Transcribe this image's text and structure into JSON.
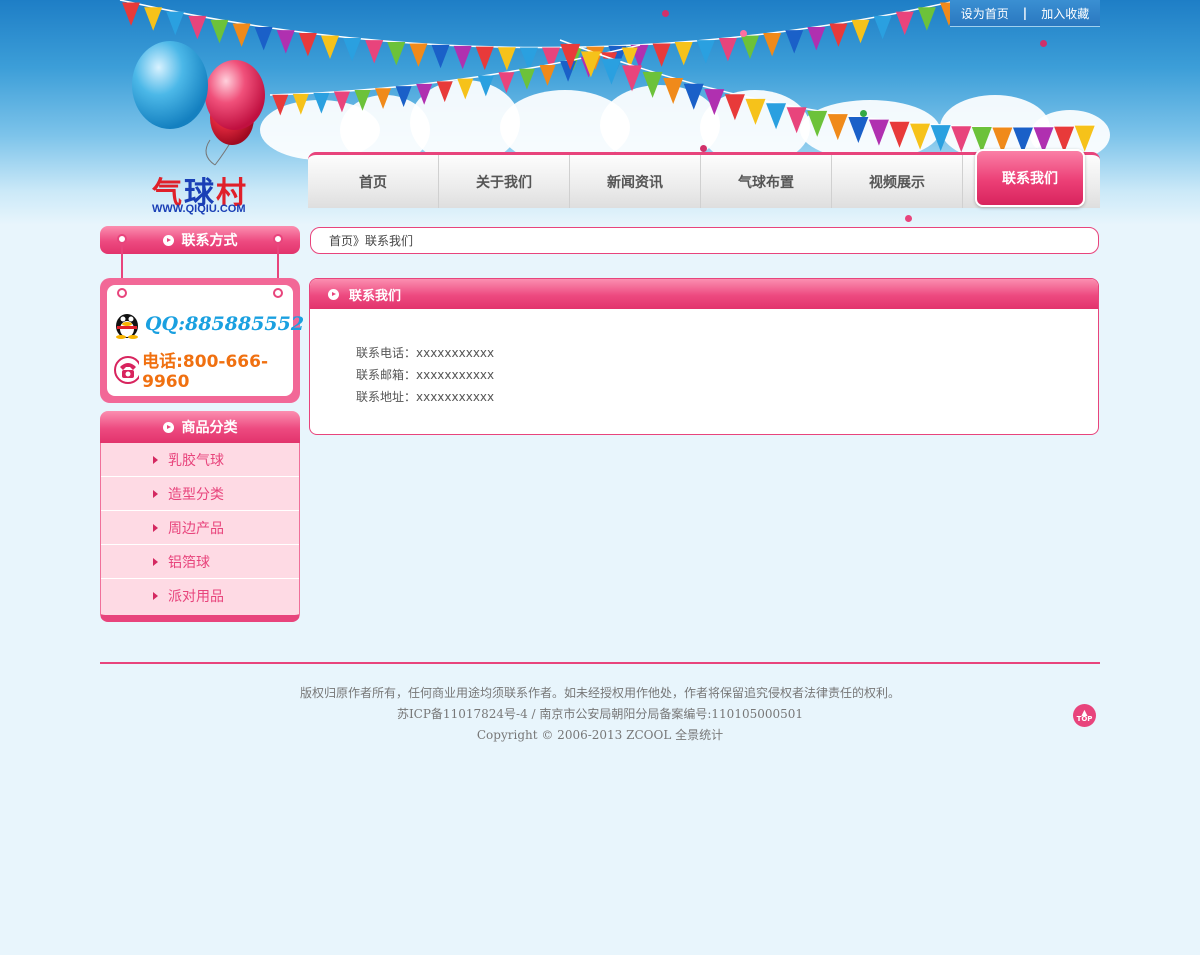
{
  "top_links": {
    "home": "设为首页",
    "favorite": "加入收藏"
  },
  "logo": {
    "text1": "气",
    "text2": "球",
    "text3": "村",
    "url": "WWW.QIQIU.COM"
  },
  "nav": [
    {
      "label": "首页"
    },
    {
      "label": "关于我们"
    },
    {
      "label": "新闻资讯"
    },
    {
      "label": "气球布置"
    },
    {
      "label": "视频展示"
    },
    {
      "label": "联系我们",
      "active": true
    }
  ],
  "sidebar": {
    "contact_title": "联系方式",
    "qq": "QQ:885885552",
    "phone": "电话:800-666-9960",
    "category_title": "商品分类",
    "categories": [
      {
        "label": "乳胶气球"
      },
      {
        "label": "造型分类"
      },
      {
        "label": "周边产品"
      },
      {
        "label": "铝箔球"
      },
      {
        "label": "派对用品"
      }
    ]
  },
  "breadcrumb": {
    "home": "首页",
    "sep": " 》",
    "current": "联系我们"
  },
  "panel": {
    "title": "联系我们",
    "lines": [
      "联系电话：xxxxxxxxxxx",
      "联系邮箱：xxxxxxxxxxx",
      "联系地址：xxxxxxxxxxx"
    ]
  },
  "footer": {
    "line1": "版权归原作者所有，任何商业用途均须联系作者。如未经授权用作他处，作者将保留追究侵权者法律责任的权利。",
    "line2": "苏ICP备11017824号-4 / 南京市公安局朝阳分局备案编号:110105000501",
    "line3": "Copyright © 2006-2013 ZCOOL 全景统计",
    "top_label": "TOP"
  },
  "colors": {
    "accent": "#e8447c",
    "sky": "#2a84c9",
    "background": "#e8f5fc"
  }
}
